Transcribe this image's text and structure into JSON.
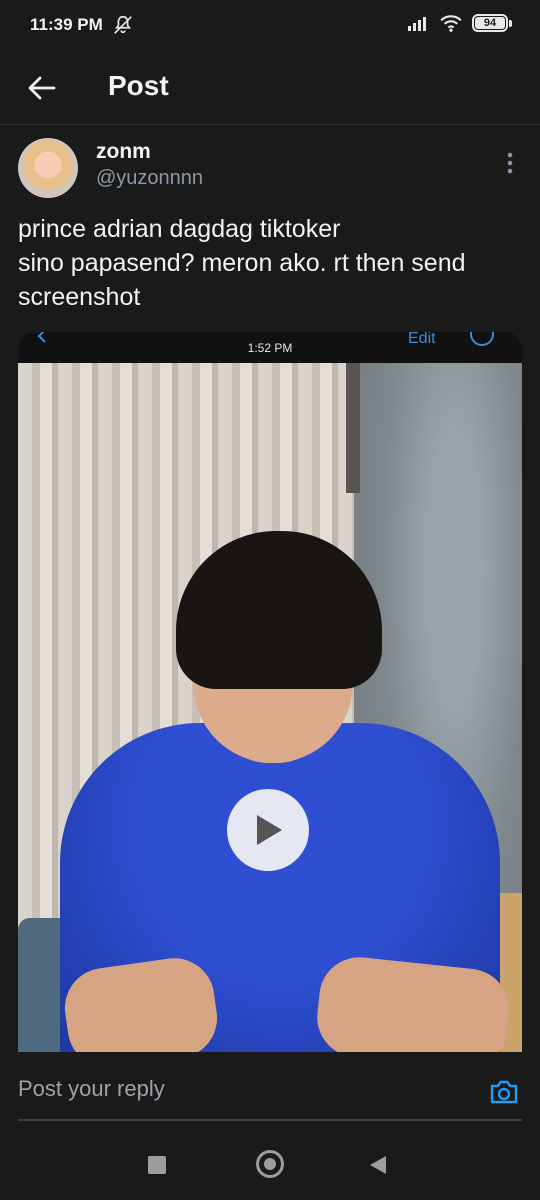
{
  "status_bar": {
    "time": "11:39 PM",
    "battery_percent": "94",
    "icons": [
      "mute-icon",
      "signal-icon",
      "wifi-icon",
      "battery-icon"
    ]
  },
  "header": {
    "title": "Post",
    "back_icon": "arrow-left-icon"
  },
  "post": {
    "author": {
      "display_name": "zonm",
      "handle": "@yuzonnnn"
    },
    "text_lines": [
      "prince adrian dagdag tiktoker",
      "sino papasend? meron ako. rt then send",
      "screenshot"
    ],
    "media": {
      "inner_status_time": "1:52 PM",
      "inner_edit_label": "Edit",
      "play_icon": "play-icon"
    }
  },
  "reply": {
    "placeholder": "Post your reply",
    "camera_icon": "camera-icon"
  },
  "nav_bar": {
    "icons": [
      "recent-apps-icon",
      "home-icon",
      "back-triangle-icon"
    ]
  },
  "colors": {
    "background": "#1a1a1a",
    "accent": "#1d9bf0",
    "secondary_text": "#8b98a5",
    "shirt_blue": "#2542b8"
  }
}
